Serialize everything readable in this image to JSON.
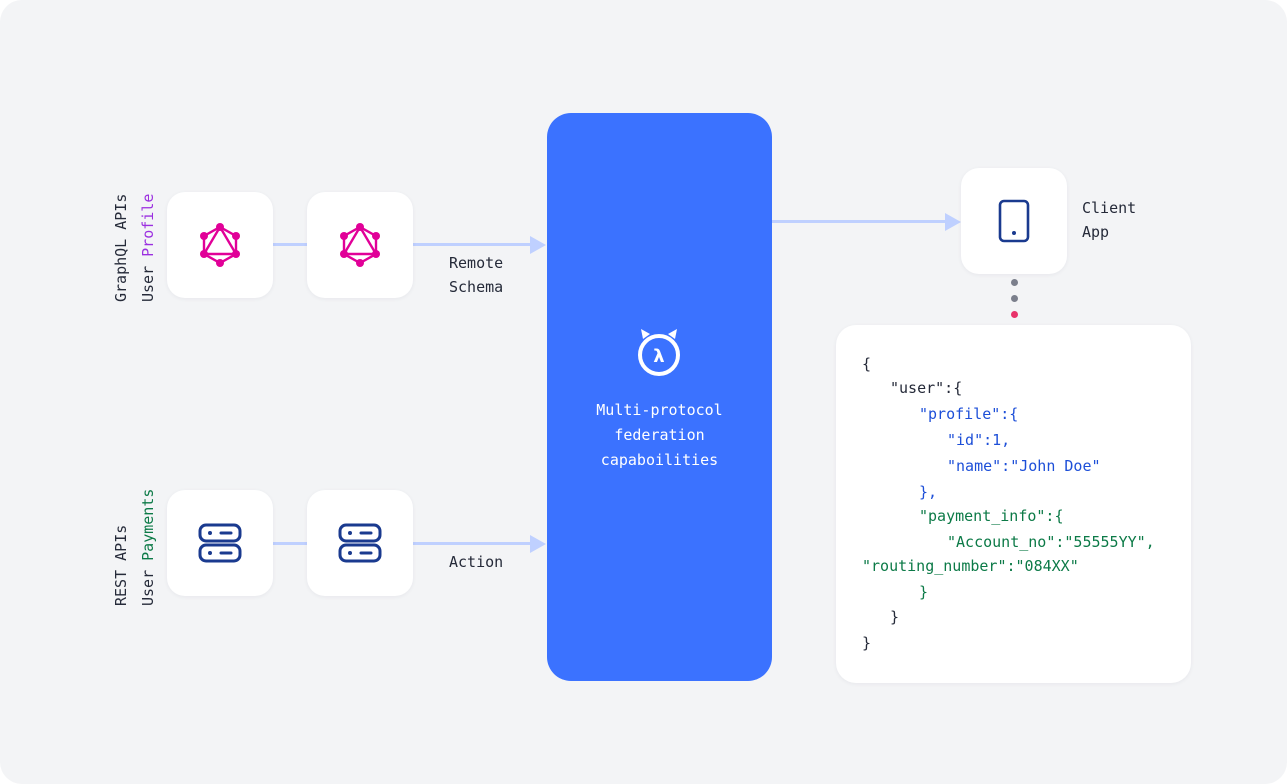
{
  "sources": {
    "graphql": {
      "line1": "GraphQL APIs",
      "line2_prefix": "User ",
      "line2_highlight": "Profile",
      "highlight_color": "#9b2fe0",
      "icon": "graphql-icon",
      "icon_color": "#e10098"
    },
    "rest": {
      "line1": "REST APIs",
      "line2_prefix": "User ",
      "line2_highlight": "Payments",
      "highlight_color": "#0c7a47",
      "icon": "server-icon",
      "icon_color": "#1a3a8f"
    }
  },
  "edges": {
    "remote_schema": {
      "line1": "Remote",
      "line2": "Schema"
    },
    "action": {
      "line1": "Action"
    }
  },
  "engine": {
    "icon": "hasura-logo-icon",
    "line1": "Multi-protocol",
    "line2": "federation",
    "line3": "capaboilities",
    "color": "#3b72ff"
  },
  "client": {
    "line1": "Client",
    "line2": "App",
    "icon": "mobile-phone-icon"
  },
  "json_response": [
    {
      "text": "{",
      "color": "dark"
    },
    {
      "text": "\"user\":{",
      "color": "dark"
    },
    {
      "text": "\"profile\":{",
      "color": "blue"
    },
    {
      "text": "\"id\":1,",
      "color": "blue"
    },
    {
      "text": "\"name\":\"John Doe\"",
      "color": "blue"
    },
    {
      "text": "},",
      "color": "blue"
    },
    {
      "text": "\"payment_info\":{",
      "color": "green"
    },
    {
      "text": "\"Account_no\":\"55555YY\",",
      "color": "green"
    },
    {
      "text": "\"routing_number\":\"084XX\"",
      "color": "green"
    },
    {
      "text": "}",
      "color": "green"
    },
    {
      "text": "}",
      "color": "dark"
    },
    {
      "text": "}",
      "color": "dark"
    }
  ],
  "colors": {
    "connector": "#bfd0ff",
    "dot_gray": "#7b7f8c",
    "dot_accent": "#e8336a"
  }
}
